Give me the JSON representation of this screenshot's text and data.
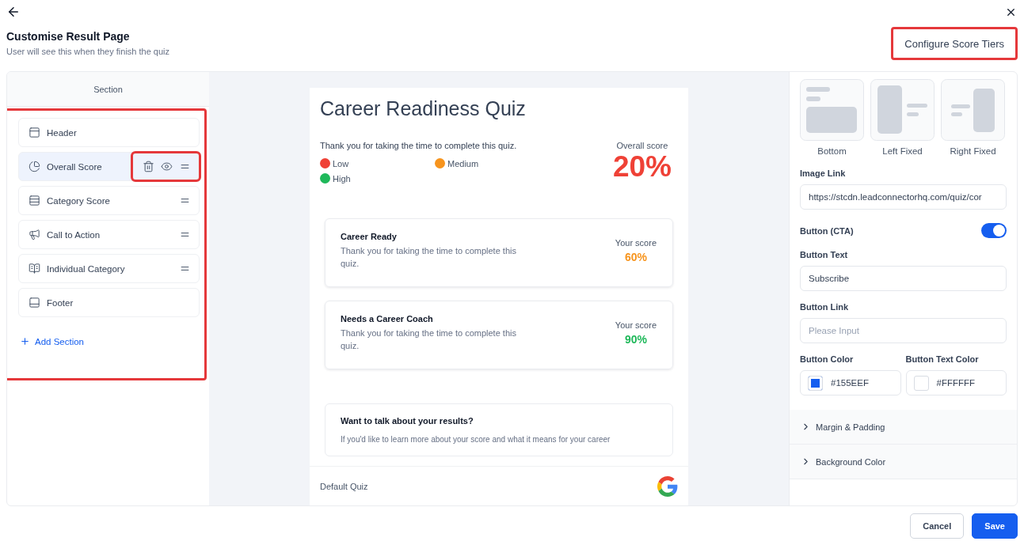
{
  "header": {
    "title": "Customise Result Page",
    "subtitle": "User will see this when they finish the quiz",
    "configure_button": {
      "label": "Configure Score Tiers",
      "highlighted": true
    }
  },
  "sections_panel": {
    "heading": "Section",
    "highlighted": true,
    "items": [
      {
        "label": "Header",
        "kind": "header",
        "selected": false,
        "draggable": false,
        "actions_highlighted": false
      },
      {
        "label": "Overall Score",
        "kind": "pie",
        "selected": true,
        "draggable": true,
        "actions_highlighted": true
      },
      {
        "label": "Category Score",
        "kind": "rows",
        "selected": false,
        "draggable": true,
        "actions_highlighted": false
      },
      {
        "label": "Call to Action",
        "kind": "megaphone",
        "selected": false,
        "draggable": true,
        "actions_highlighted": false
      },
      {
        "label": "Individual Category",
        "kind": "book",
        "selected": false,
        "draggable": true,
        "actions_highlighted": false
      },
      {
        "label": "Footer",
        "kind": "footer",
        "selected": false,
        "draggable": false,
        "actions_highlighted": false
      }
    ],
    "add_label": "Add Section"
  },
  "preview": {
    "title": "Career Readiness Quiz",
    "message": "Thank you for taking the time to complete this quiz.",
    "legend": [
      {
        "label": "Low",
        "color": "#ef4136"
      },
      {
        "label": "Medium",
        "color": "#f7941d"
      },
      {
        "label": "High",
        "color": "#1fb85a"
      }
    ],
    "overall_label": "Overall score",
    "overall_value": "20%",
    "categories": [
      {
        "title": "Career Ready",
        "text": "Thank you for taking the time to complete this quiz.",
        "score_label": "Your score",
        "score": "60%",
        "color": "#f7941d"
      },
      {
        "title": "Needs a Career Coach",
        "text": "Thank you for taking the time to complete this quiz.",
        "score_label": "Your score",
        "score": "90%",
        "color": "#1fb85a"
      }
    ],
    "cta": {
      "title": "Want to talk about your results?",
      "text": "If you'd like to learn more about your score and what it means for your career"
    },
    "footer_label": "Default Quiz"
  },
  "settings": {
    "layouts": [
      {
        "label": "Bottom",
        "kind": "bottom"
      },
      {
        "label": "Left Fixed",
        "kind": "left"
      },
      {
        "label": "Right Fixed",
        "kind": "right"
      }
    ],
    "image_link_label": "Image Link",
    "image_link": "https://stcdn.leadconnectorhq.com/quiz/cor",
    "cta_label": "Button (CTA)",
    "cta_on": true,
    "button_text_label": "Button Text",
    "button_text": "Subscribe",
    "button_link_label": "Button Link",
    "button_link_placeholder": "Please Input",
    "button_color_label": "Button Color",
    "button_color": "#155EEF",
    "button_text_color_label": "Button Text Color",
    "button_text_color": "#FFFFFF",
    "accordions": [
      {
        "label": "Margin & Padding",
        "expanded": false
      },
      {
        "label": "Background Color",
        "expanded": false
      }
    ]
  },
  "actions": {
    "cancel": "Cancel",
    "save": "Save"
  }
}
